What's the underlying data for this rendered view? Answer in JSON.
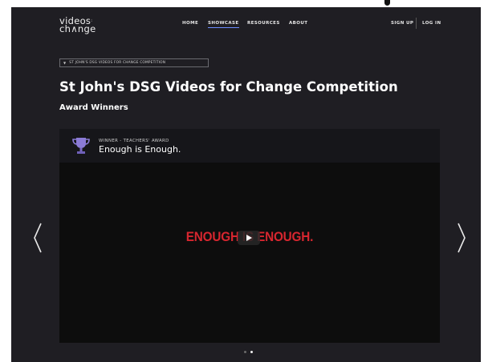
{
  "logo": {
    "line1": "videos",
    "line2": "ch∧nge"
  },
  "nav": {
    "items": [
      {
        "label": "HOME",
        "active": false
      },
      {
        "label": "SHOWCASE",
        "active": true
      },
      {
        "label": "RESOURCES",
        "active": false
      },
      {
        "label": "ABOUT",
        "active": false
      }
    ],
    "sign_up": "SIGN UP",
    "log_in": "LOG IN"
  },
  "breadcrumb": {
    "label": "ST JOHN'S DSG VIDEOS FOR CHANGE COMPETITION"
  },
  "page": {
    "title": "St John's DSG Videos for Change Competition",
    "subtitle": "Award Winners"
  },
  "video": {
    "award_label": "WINNER - TEACHERS' AWARD",
    "title": "Enough is Enough.",
    "frame_text": "ENOUGH IS ENOUGH.",
    "icon": "trophy-icon",
    "play_icon": "play-icon"
  },
  "carousel": {
    "slide_count": 2,
    "active_index": 1
  },
  "colors": {
    "background": "#1f1e23",
    "accent": "#6c8cff",
    "video_text": "#d7262f",
    "trophy": "#8b7bd6"
  }
}
